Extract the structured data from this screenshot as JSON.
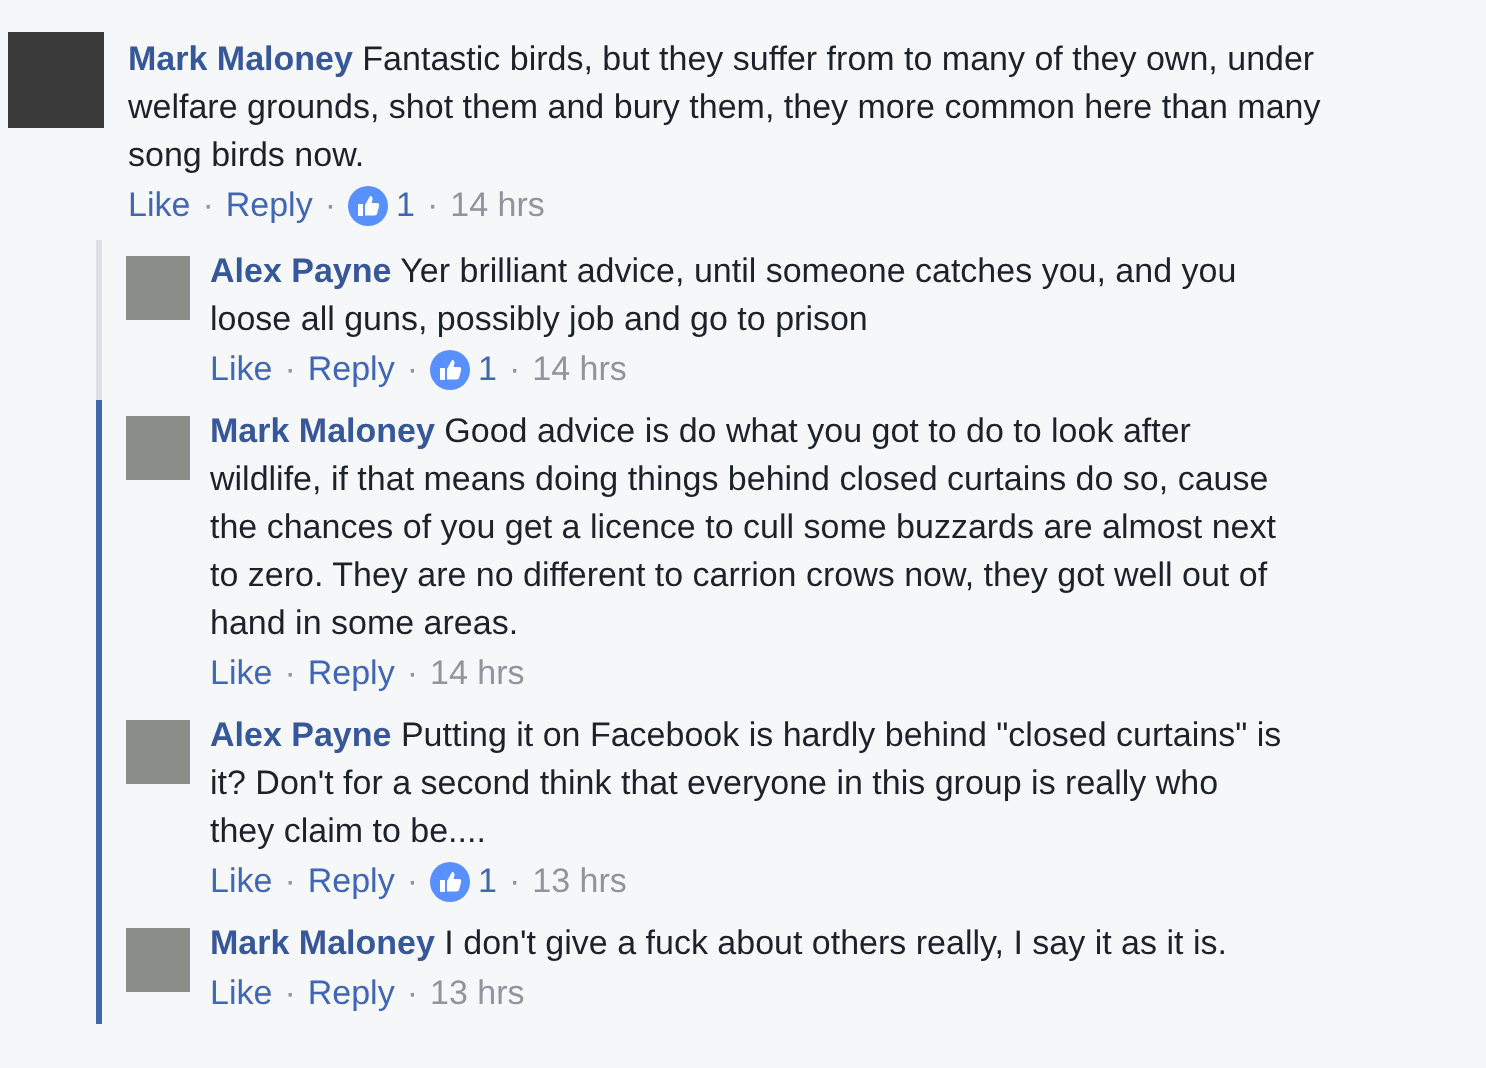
{
  "comment": {
    "author": "Mark Maloney",
    "text": "Fantastic birds, but they suffer from to many of they own, under welfare grounds, shot them and bury them, they more common here than many song birds now.",
    "like": "Like",
    "reply": "Reply",
    "likes": "1",
    "time": "14 hrs",
    "separator": "·",
    "replies": [
      {
        "author": "Alex Payne",
        "text": "Yer brilliant advice, until someone catches you, and you loose all guns, possibly job and go to prison",
        "like": "Like",
        "reply": "Reply",
        "likes": "1",
        "time": "14 hrs",
        "separator": "·",
        "highlighted": false
      },
      {
        "author": "Mark Maloney",
        "text": "Good advice is do what you got to do to look after wildlife, if that means doing things behind closed curtains do so, cause the chances of you get a licence to cull some buzzards are almost next to zero. They are no different to carrion crows now, they got well out of hand in some areas.",
        "like": "Like",
        "reply": "Reply",
        "time": "14 hrs",
        "separator": "·",
        "highlighted": true
      },
      {
        "author": "Alex Payne",
        "text": "Putting it on Facebook is hardly behind \"closed curtains\" is it? Don't for a second think that everyone in this group is really who they claim to be....",
        "like": "Like",
        "reply": "Reply",
        "likes": "1",
        "time": "13 hrs",
        "separator": "·",
        "highlighted": true
      },
      {
        "author": "Mark Maloney",
        "text": "I don't give a fuck about others really, I say it as it is.",
        "like": "Like",
        "reply": "Reply",
        "time": "13 hrs",
        "separator": "·",
        "highlighted": true
      }
    ]
  }
}
